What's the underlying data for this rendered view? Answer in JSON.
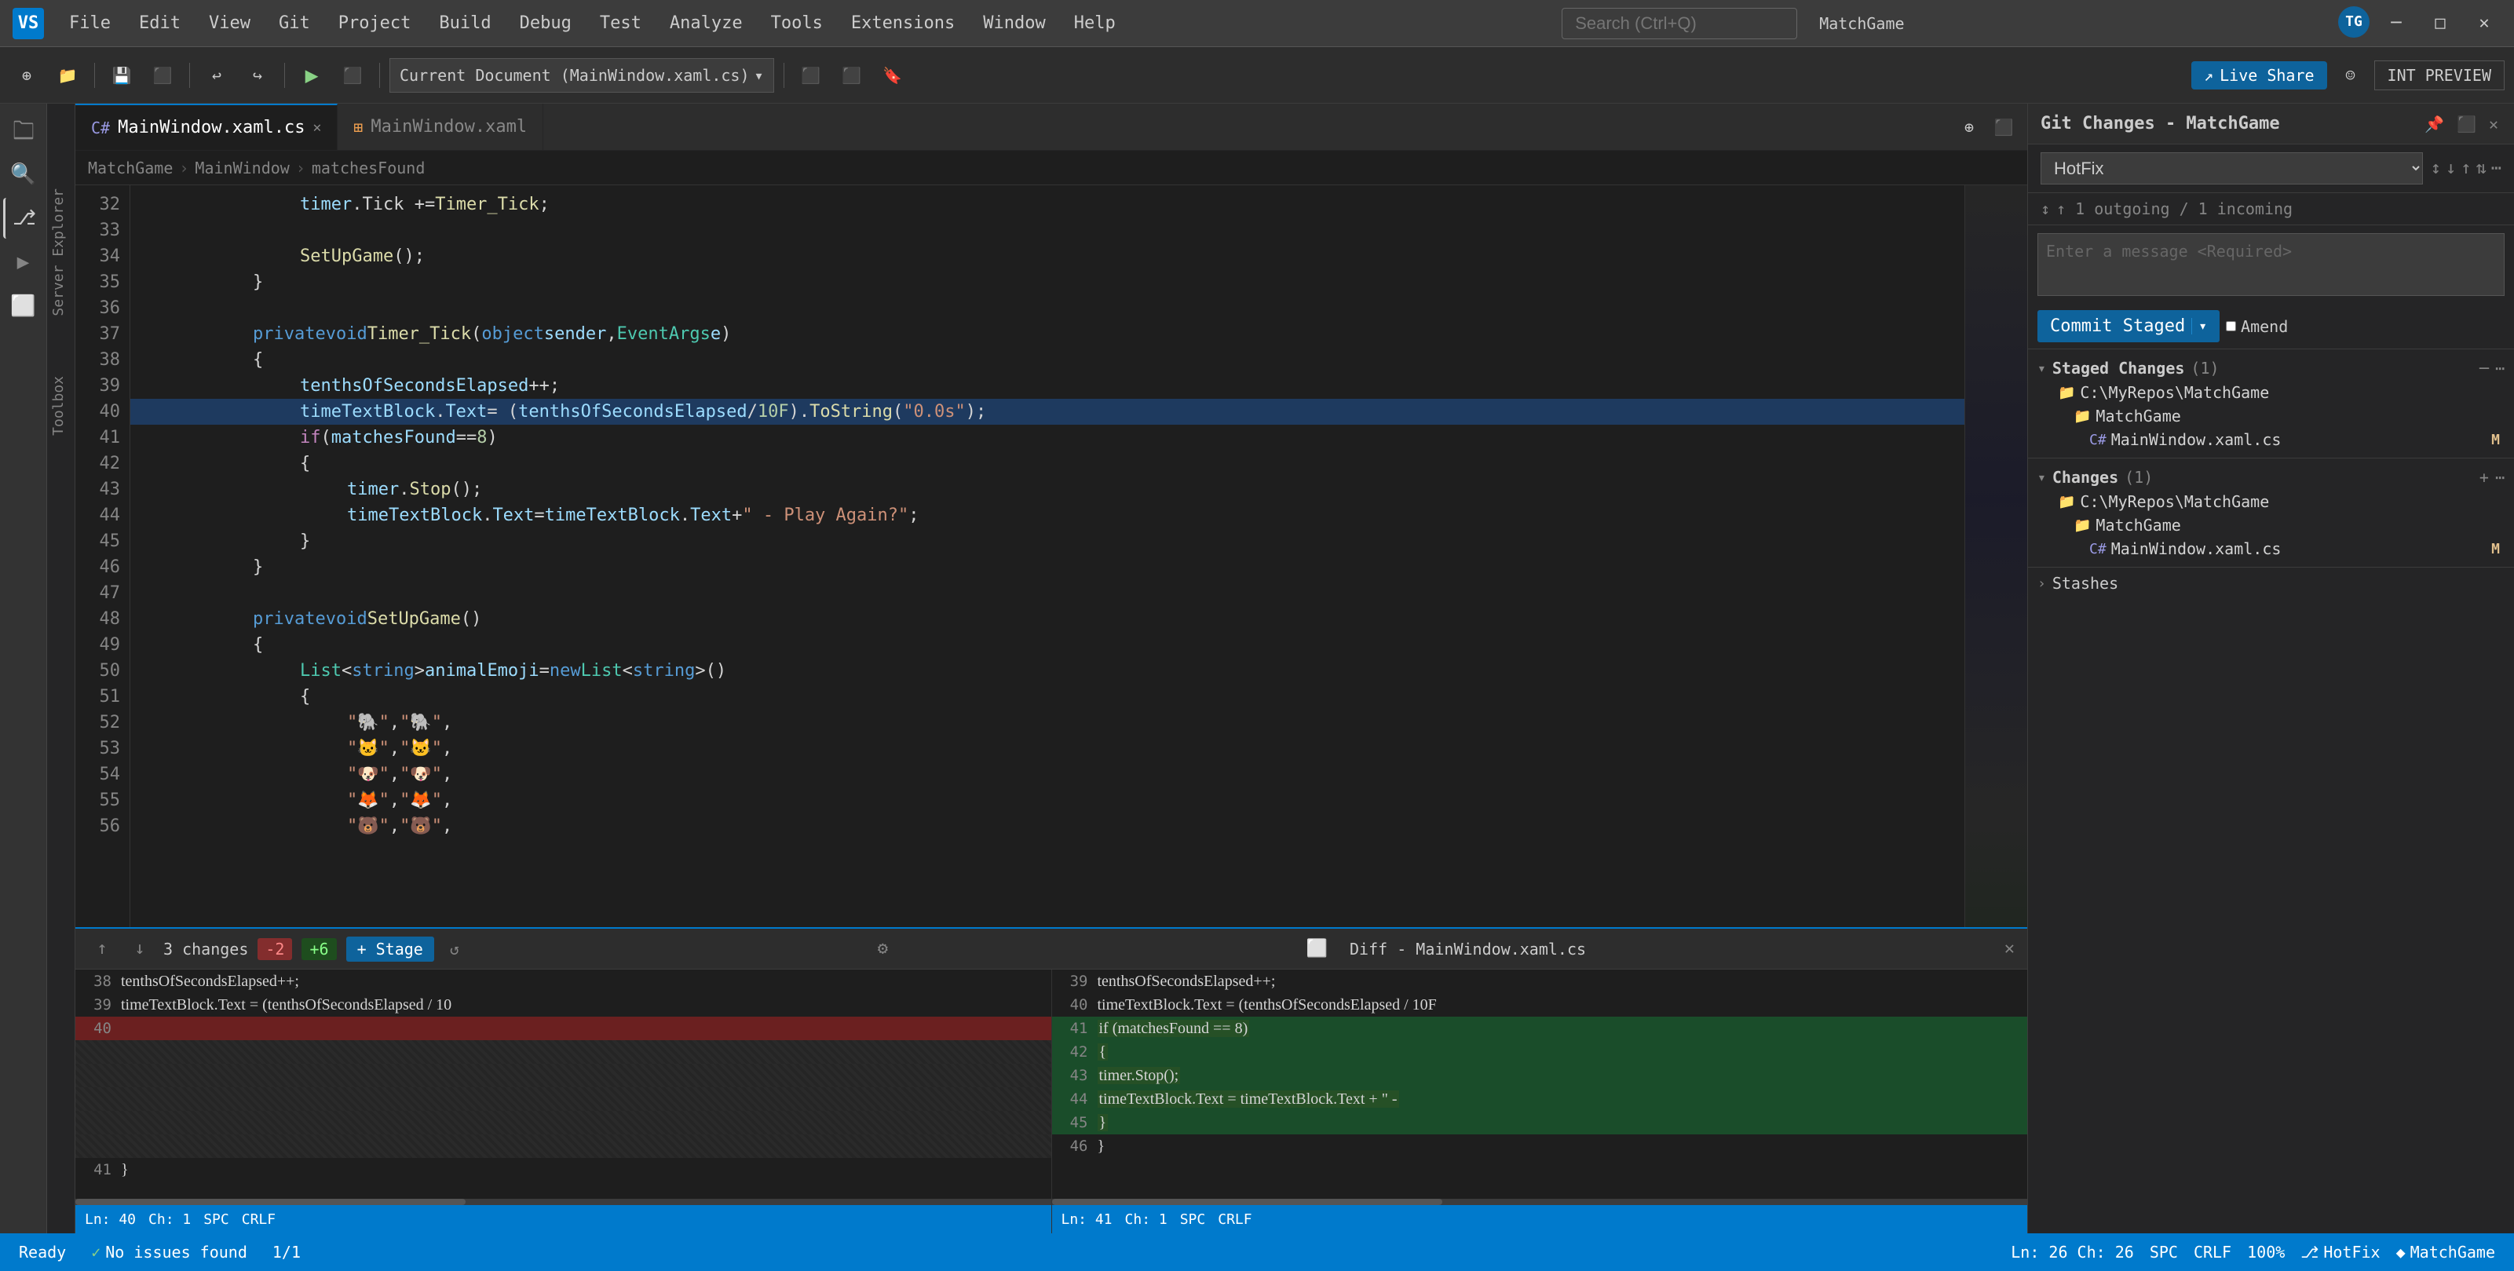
{
  "app": {
    "title": "MatchGame",
    "icon": "VS"
  },
  "menu": {
    "items": [
      "File",
      "Edit",
      "View",
      "Git",
      "Project",
      "Build",
      "Debug",
      "Test",
      "Analyze",
      "Tools",
      "Extensions",
      "Window",
      "Help"
    ],
    "search_placeholder": "Search (Ctrl+Q)"
  },
  "window_controls": {
    "minimize": "─",
    "maximize": "□",
    "close": "✕"
  },
  "toolbar": {
    "live_share_label": "Live Share",
    "int_preview_label": "INT PREVIEW",
    "run_dropdown": "Current Document (MainWindow.xaml.cs)"
  },
  "activity_bar": {
    "items": [
      "server-explorer-icon",
      "toolbox-icon"
    ]
  },
  "vertical_labels": {
    "items": [
      "Server Explorer",
      "Toolbox"
    ]
  },
  "tabs": {
    "items": [
      {
        "label": "MainWindow.xaml.cs",
        "type": "cs",
        "active": true,
        "closeable": true
      },
      {
        "label": "MainWindow.xaml",
        "type": "xml",
        "active": false,
        "closeable": false
      }
    ]
  },
  "breadcrumb": {
    "items": [
      "MatchGame",
      "MainWindow",
      "matchesFound"
    ]
  },
  "code": {
    "lines": [
      {
        "num": 32,
        "text": "            timer.Tick += Timer_Tick;"
      },
      {
        "num": 33,
        "text": ""
      },
      {
        "num": 34,
        "text": "            SetUpGame();"
      },
      {
        "num": 35,
        "text": "        }"
      },
      {
        "num": 36,
        "text": ""
      },
      {
        "num": 37,
        "text": "        private void Timer_Tick(object sender, EventArgs e)"
      },
      {
        "num": 38,
        "text": "        {"
      },
      {
        "num": 39,
        "text": "            tenthsOfSecondsElapsed++;"
      },
      {
        "num": 40,
        "text": "            timeTextBlock.Text = (tenthsOfSecondsElapsed / 10F).ToString(\"0.0s\");"
      },
      {
        "num": 41,
        "text": "            if (matchesFound == 8)"
      },
      {
        "num": 42,
        "text": "            {"
      },
      {
        "num": 43,
        "text": "                timer.Stop();"
      },
      {
        "num": 44,
        "text": "                timeTextBlock.Text = timeTextBlock.Text + \" - Play Again?\";"
      },
      {
        "num": 45,
        "text": "            }"
      },
      {
        "num": 46,
        "text": "        }"
      },
      {
        "num": 47,
        "text": ""
      },
      {
        "num": 48,
        "text": "        private void SetUpGame()"
      },
      {
        "num": 49,
        "text": "        {"
      },
      {
        "num": 50,
        "text": "            List<string> animalEmoji = new List<string>()"
      },
      {
        "num": 51,
        "text": "            {"
      },
      {
        "num": 52,
        "text": "                \"🐘\", \"🐘\","
      },
      {
        "num": 53,
        "text": "                \"🐱\", \"🐱\","
      },
      {
        "num": 54,
        "text": "                \"🐶\", \"🐶\","
      },
      {
        "num": 55,
        "text": "                \"🦊\", \"🦊\","
      },
      {
        "num": 56,
        "text": "                \"🐻\", \"🐻\","
      }
    ]
  },
  "diff": {
    "title": "Diff - MainWindow.xaml.cs",
    "changes_count": "3 changes",
    "del_count": "-2",
    "add_count": "+6",
    "stage_label": "+ Stage",
    "left_lines": [
      {
        "num": 38,
        "text": "            tenthsOfSecondsElapsed++;",
        "type": "normal"
      },
      {
        "num": 39,
        "text": "            timeTextBlock.Text = (tenthsOfSecondsElapsed / 10",
        "type": "normal"
      },
      {
        "num": 40,
        "text": "",
        "type": "removed"
      },
      {
        "num": "",
        "text": "",
        "type": "empty"
      },
      {
        "num": "",
        "text": "",
        "type": "empty"
      },
      {
        "num": "",
        "text": "",
        "type": "empty"
      },
      {
        "num": "",
        "text": "",
        "type": "empty"
      },
      {
        "num": "",
        "text": "",
        "type": "empty"
      },
      {
        "num": 41,
        "text": "            }",
        "type": "normal"
      }
    ],
    "right_lines": [
      {
        "num": 39,
        "text": "            tenthsOfSecondsElapsed++;",
        "type": "normal"
      },
      {
        "num": 40,
        "text": "            timeTextBlock.Text = (tenthsOfSecondsElapsed / 10F",
        "type": "normal"
      },
      {
        "num": 41,
        "text": "            if (matchesFound == 8)",
        "type": "added"
      },
      {
        "num": 42,
        "text": "            {",
        "type": "added"
      },
      {
        "num": 43,
        "text": "                timer.Stop();",
        "type": "added"
      },
      {
        "num": 44,
        "text": "                timeTextBlock.Text = timeTextBlock.Text + \" -",
        "type": "added"
      },
      {
        "num": 45,
        "text": "            }",
        "type": "added"
      },
      {
        "num": 46,
        "text": "            }",
        "type": "normal"
      }
    ],
    "left_footer": {
      "ln": "Ln: 40",
      "ch": "Ch: 1",
      "enc": "SPC",
      "eol": "CRLF"
    },
    "right_footer": {
      "ln": "Ln: 41",
      "ch": "Ch: 1",
      "enc": "SPC",
      "eol": "CRLF"
    }
  },
  "git_panel": {
    "title": "Git Changes - MatchGame",
    "branch": "HotFix",
    "sync_info": "↑ 1 outgoing / 1 incoming",
    "message_placeholder": "Enter a message <Required>",
    "commit_staged_label": "Commit Staged",
    "amend_label": "Amend",
    "staged_changes": {
      "title": "Staged Changes",
      "count": "(1)",
      "repo": "C:\\MyRepos\\MatchGame",
      "folder": "MatchGame",
      "file": "MainWindow.xaml.cs",
      "badge": "M"
    },
    "changes": {
      "title": "Changes",
      "count": "(1)",
      "repo": "C:\\MyRepos\\MatchGame",
      "folder": "MatchGame",
      "file": "MainWindow.xaml.cs",
      "badge": "M"
    },
    "stashes": {
      "title": "Stashes"
    }
  },
  "status_bar": {
    "ready_label": "Ready",
    "branch_label": "HotFix",
    "match_label": "MatchGame",
    "issues_label": "No issues found",
    "ln_info": "Ln: 26  Ch: 26",
    "enc": "SPC",
    "eol": "CRLF",
    "nav_info": "1/1",
    "zoom": "100%"
  }
}
